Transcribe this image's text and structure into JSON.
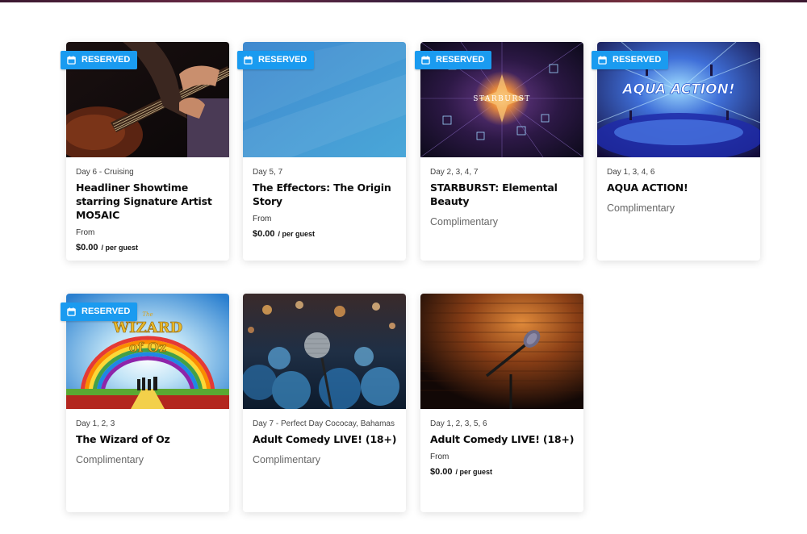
{
  "badge_label": "RESERVED",
  "cards": [
    {
      "days": "Day 6 - Cruising",
      "title": "Headliner Showtime starring Signature Artist MO5AIC",
      "from_label": "From",
      "price": "$0.00",
      "per": "/ per guest",
      "image": "bass-guitar-player"
    },
    {
      "days": "Day 5, 7",
      "title": "The Effectors: The Origin Story",
      "from_label": "From",
      "price": "$0.00",
      "per": "/ per guest",
      "image": "blue-gradient"
    },
    {
      "days": "Day 2, 3, 4, 7",
      "title": "STARBURST: Elemental Beauty",
      "complimentary": "Complimentary",
      "image": "starburst-show",
      "image_text": "STARBURST"
    },
    {
      "days": "Day 1, 3, 4, 6",
      "title": "AQUA ACTION!",
      "complimentary": "Complimentary",
      "image": "aqua-action-show",
      "image_text": "AQUA ACTION!"
    },
    {
      "days": "Day 1, 2, 3",
      "title": "The Wizard of Oz",
      "complimentary": "Complimentary",
      "image": "wizard-of-oz-poster",
      "image_text_1": "The",
      "image_text_2": "WIZARD",
      "image_text_3": "of Oz"
    },
    {
      "days": "Day 7 - Perfect Day Cococay, Bahamas",
      "title": "Adult Comedy LIVE! (18+)",
      "complimentary": "Complimentary",
      "image": "microphone-crowd"
    },
    {
      "days": "Day 1, 2, 3, 5, 6",
      "title": "Adult Comedy LIVE! (18+)",
      "from_label": "From",
      "price": "$0.00",
      "per": "/ per guest",
      "image": "microphone-brick-wall"
    }
  ]
}
